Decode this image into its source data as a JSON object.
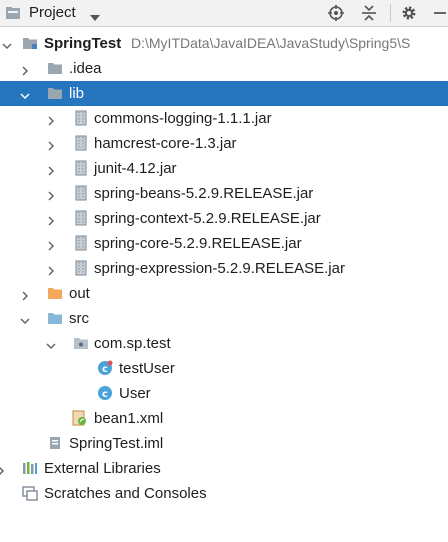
{
  "toolbar": {
    "title": "Project",
    "icons": [
      "project-icon",
      "chevron-down-icon",
      "locate-icon",
      "collapse-all-icon",
      "gear-icon",
      "hide-icon"
    ]
  },
  "tree": {
    "root": {
      "name": "SpringTest",
      "path": "D:\\MyITData\\JavaIDEA\\JavaStudy\\Spring5\\S"
    },
    "idea": ".idea",
    "lib": "lib",
    "jars": [
      "commons-logging-1.1.1.jar",
      "hamcrest-core-1.3.jar",
      "junit-4.12.jar",
      "spring-beans-5.2.9.RELEASE.jar",
      "spring-context-5.2.9.RELEASE.jar",
      "spring-core-5.2.9.RELEASE.jar",
      "spring-expression-5.2.9.RELEASE.jar"
    ],
    "out": "out",
    "src": "src",
    "package": "com.sp.test",
    "classes": [
      "testUser",
      "User"
    ],
    "xml": "bean1.xml",
    "iml": "SpringTest.iml",
    "external": "External Libraries",
    "scratches": "Scratches and Consoles"
  },
  "colors": {
    "selection": "#2675bf",
    "folder": "#9aa7b0",
    "out_folder": "#f4a85c",
    "src_folder": "#87b8d9"
  }
}
